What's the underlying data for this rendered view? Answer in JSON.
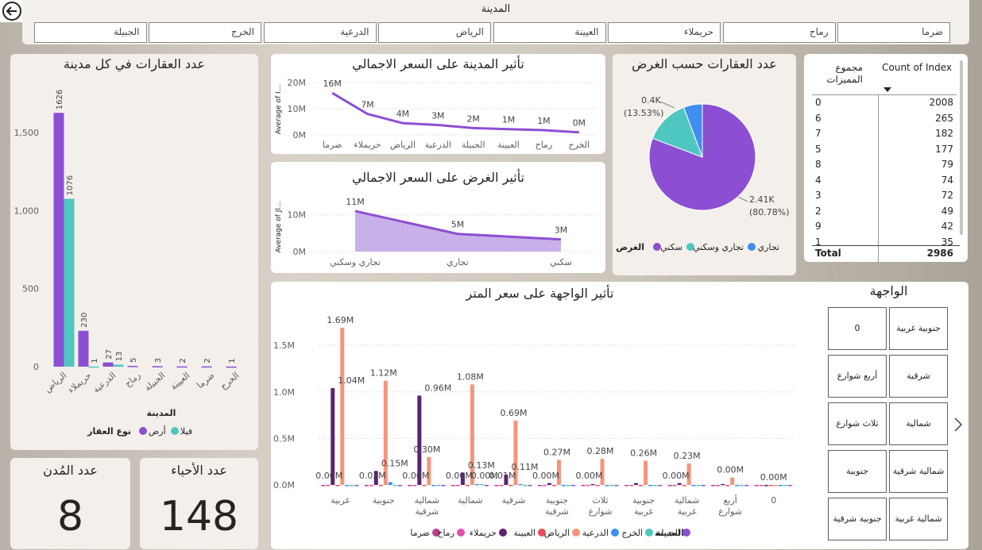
{
  "back_icon": "circle-arrow-left-icon",
  "city_slicer": {
    "title": "المدينة",
    "items": [
      "ضرما",
      "رماح",
      "حريملاء",
      "العيينة",
      "الرياض",
      "الدرعية",
      "الخرج",
      "الجبيلة"
    ]
  },
  "left_chart": {
    "title": "عدد العقارات في كل مدينة",
    "chart_data": {
      "type": "bar",
      "categories": [
        "الرياض",
        "حريملاء",
        "الدرعية",
        "رماح",
        "الجبيلة",
        "العيينة",
        "ضرما",
        "الخرج"
      ],
      "series": [
        {
          "name": "أرض",
          "values": [
            1626,
            230,
            27,
            5,
            3,
            2,
            2,
            1
          ],
          "color": "#8c4fd4"
        },
        {
          "name": "فيلا",
          "values": [
            1076,
            1,
            13,
            0,
            0,
            0,
            0,
            0
          ],
          "color": "#4fc7c1"
        }
      ],
      "data_labels": [
        [
          "1626",
          "1076"
        ],
        [
          "230",
          "1"
        ],
        [
          "27",
          "13"
        ],
        [
          "5",
          ""
        ],
        [
          "3",
          ""
        ],
        [
          "2",
          ""
        ],
        [
          "2",
          ""
        ],
        [
          "1",
          ""
        ]
      ],
      "yticks": [
        "0",
        "500",
        "1,000",
        "1,500"
      ],
      "ylim": [
        0,
        1800
      ],
      "xlabel": "المدينة",
      "legend_title": "نوع العقار"
    }
  },
  "city_price_chart": {
    "title": "تأثير المدينة على السعر الاجمالي",
    "chart_data": {
      "type": "line",
      "categories": [
        "ضرما",
        "حريملاء",
        "الرياض",
        "الدرعية",
        "الجبيلة",
        "العيينة",
        "رماح",
        "الخرج"
      ],
      "values": [
        16,
        7,
        4,
        3,
        2,
        1,
        1,
        0
      ],
      "y_values_plot": [
        16,
        8,
        4.5,
        3.8,
        2.6,
        2.2,
        1.8,
        1.0
      ],
      "data_labels": [
        "16M",
        "7M",
        "4M",
        "3M",
        "2M",
        "1M",
        "1M",
        "0M"
      ],
      "yticks": [
        "0M",
        "10M",
        "20M"
      ],
      "ylim": [
        0,
        20
      ],
      "ylabel": "Average of I..."
    }
  },
  "purpose_price_chart": {
    "title": "تأثير الغرض على السعر الاجمالي",
    "chart_data": {
      "type": "area",
      "categories": [
        "تجاري وسكني",
        "تجاري",
        "سكني"
      ],
      "values": [
        11,
        5,
        3
      ],
      "y_values_plot": [
        11,
        4.8,
        3.3
      ],
      "data_labels": [
        "11M",
        "5M",
        "3M"
      ],
      "yticks": [
        "0M",
        "10M"
      ],
      "ylim": [
        0,
        14
      ],
      "ylabel": "Average of Jl..."
    }
  },
  "pie_chart": {
    "title": "عدد العقارات حسب الغرض",
    "chart_data": {
      "type": "pie",
      "slices": [
        {
          "name": "سكني",
          "value": 80.78,
          "label": "2.41K",
          "pct": "(80.78%)",
          "color": "#8c4fd4"
        },
        {
          "name": "تجاري وسكني",
          "value": 13.53,
          "label": "0.4K",
          "pct": "(13.53%)",
          "color": "#4fc7c1"
        },
        {
          "name": "تجاري",
          "value": 5.69,
          "label": "",
          "pct": "",
          "color": "#3f8ef0"
        }
      ],
      "legend_title": "الغرض"
    }
  },
  "matrix": {
    "col1": "مجموع المميزات",
    "col2": "Count of Index",
    "rows": [
      [
        "0",
        "2008"
      ],
      [
        "6",
        "265"
      ],
      [
        "7",
        "182"
      ],
      [
        "5",
        "177"
      ],
      [
        "8",
        "79"
      ],
      [
        "4",
        "74"
      ],
      [
        "3",
        "72"
      ],
      [
        "2",
        "49"
      ],
      [
        "9",
        "42"
      ],
      [
        "1",
        "35"
      ]
    ],
    "total_label": "Total",
    "total_value": "2986"
  },
  "facade_chart": {
    "title": "تأثير الواجهة على سعر المتر",
    "chart_data": {
      "type": "bar",
      "categories": [
        "غربية",
        "جنوبية",
        "شمالية شرقية",
        "شمالية",
        "شرقية",
        "جنوبية شرقية",
        "ثلاث شوارع",
        "جنوبية غربية",
        "شمالية غربية",
        "أربع شوارع",
        "0"
      ],
      "yticks": [
        "0.0M",
        "0.5M",
        "1.0M",
        "1.5M"
      ],
      "ylim": [
        0,
        1.8
      ],
      "labels": [
        [
          "0.00M",
          "1.69M",
          "1.04M"
        ],
        [
          "0.03M",
          "1.12M",
          "0.15M"
        ],
        [
          "0.00M",
          "0.30M",
          "0.96M"
        ],
        [
          "0.00M",
          "1.08M",
          "0.13M",
          "0.00M"
        ],
        [
          "0.01M",
          "0.69M",
          "0.11M"
        ],
        [
          "0.00M",
          "0.27M"
        ],
        [
          "0.00M",
          "0.28M"
        ],
        [
          "0.26M"
        ],
        [
          "0.00M",
          "0.23M"
        ],
        [
          "0.00M"
        ],
        [
          "0.00M"
        ]
      ],
      "series": [
        {
          "name": "ضرما",
          "color": "#b83f92",
          "values": [
            0,
            0,
            0,
            0,
            0,
            0,
            0,
            0,
            0,
            0,
            0
          ]
        },
        {
          "name": "رماح",
          "color": "#e04fa8",
          "values": [
            0,
            0,
            0,
            0,
            0,
            0,
            0,
            0,
            0,
            0,
            0
          ]
        },
        {
          "name": "حريملاء",
          "color": "#5b2374",
          "values": [
            1.04,
            0.15,
            0.96,
            0.13,
            0.11,
            0.02,
            0.01,
            0.02,
            0.02,
            0.01,
            0
          ]
        },
        {
          "name": "العيينة",
          "color": "#e64f5a",
          "values": [
            0,
            0,
            0,
            0,
            0,
            0,
            0,
            0,
            0,
            0,
            0
          ]
        },
        {
          "name": "الرياض",
          "color": "#f5957a",
          "values": [
            1.69,
            1.12,
            0.3,
            1.08,
            0.69,
            0.27,
            0.28,
            0.26,
            0.23,
            0.08,
            0
          ]
        },
        {
          "name": "الدرعية",
          "color": "#3f8ef0",
          "values": [
            0,
            0.03,
            0,
            0.01,
            0.01,
            0,
            0,
            0,
            0,
            0,
            0
          ]
        },
        {
          "name": "الخرج",
          "color": "#4fc7c1",
          "values": [
            0,
            0,
            0,
            0.01,
            0,
            0,
            0,
            0,
            0,
            0,
            0
          ]
        },
        {
          "name": "الجبيلة",
          "color": "#8c4fd4",
          "values": [
            0,
            0,
            0,
            0,
            0,
            0,
            0,
            0,
            0,
            0,
            0
          ]
        }
      ],
      "legend_title": "المدينة"
    }
  },
  "facade_slicer": {
    "title": "الواجهة",
    "tiles": [
      [
        "جنوبية غربية",
        "0"
      ],
      [
        "شرقية",
        "أربع شوارع"
      ],
      [
        "شمالية",
        "ثلاث شوارع"
      ],
      [
        "شمالية شرقية",
        "جنوبية"
      ],
      [
        "شمالية غربية",
        "جنوبية شرقية"
      ]
    ],
    "next_icon": "chevron-right-icon"
  },
  "kpi_cities": {
    "title": "عدد المُدن",
    "value": "8"
  },
  "kpi_districts": {
    "title": "عدد الأحياء",
    "value": "148"
  }
}
